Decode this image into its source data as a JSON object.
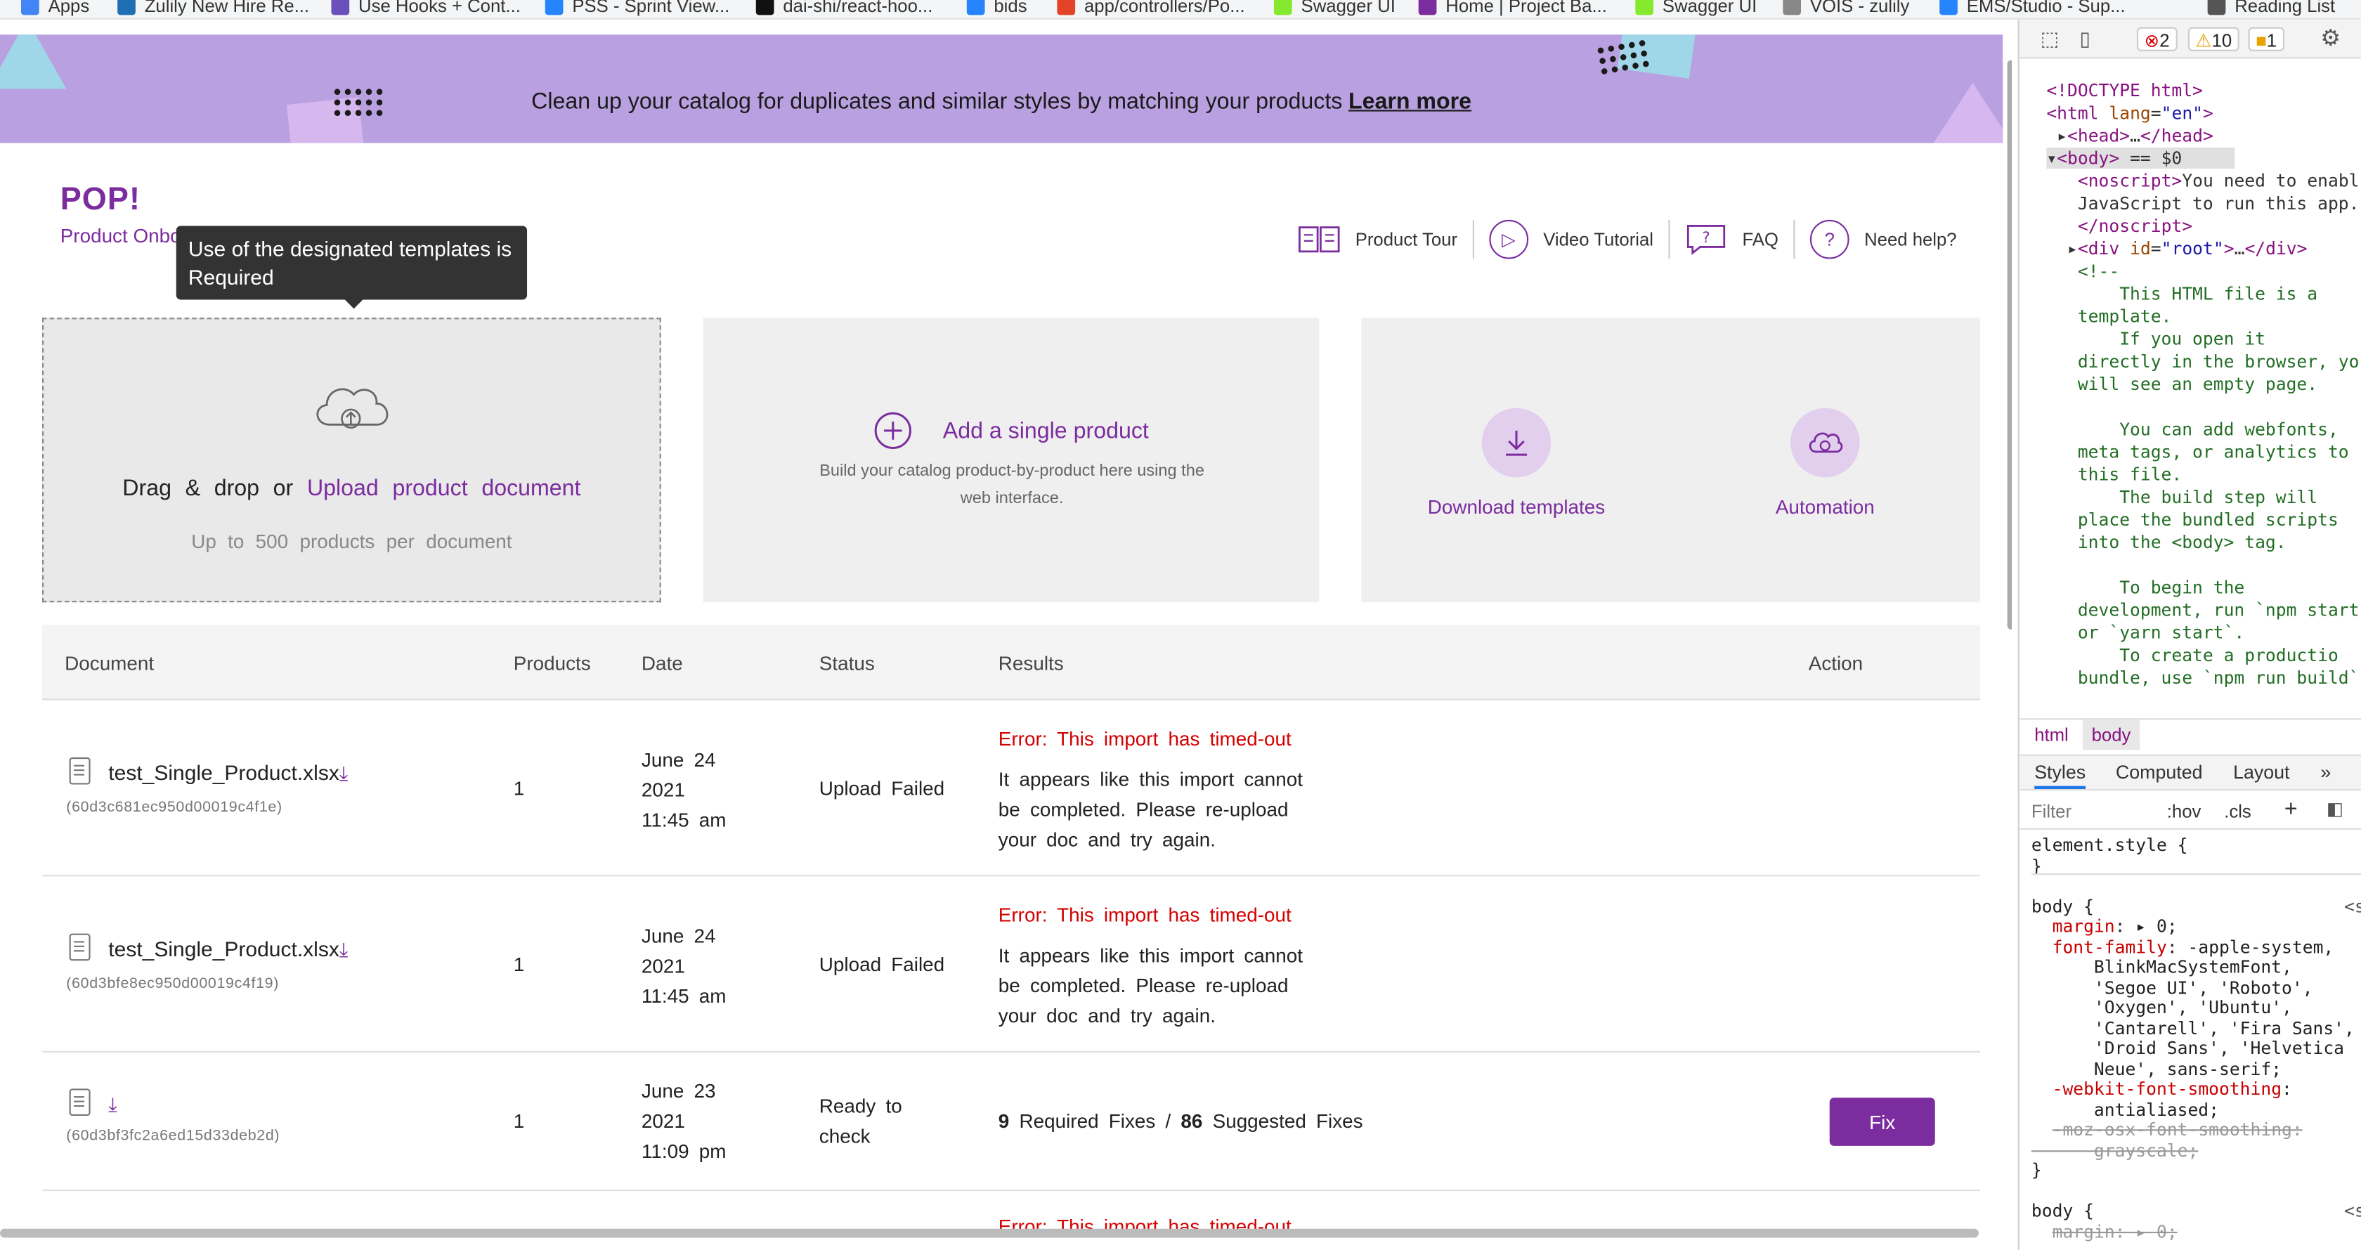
{
  "bookmarks": [
    {
      "label": "Apps",
      "color": "#4285f4"
    },
    {
      "label": "Zulily New Hire Re...",
      "color": "#1f6fb5"
    },
    {
      "label": "Use Hooks + Cont...",
      "color": "#6b4fbb"
    },
    {
      "label": "PSS - Sprint View...",
      "color": "#2684ff"
    },
    {
      "label": "dai-shi/react-hoo...",
      "color": "#111111"
    },
    {
      "label": "bids",
      "color": "#2684ff"
    },
    {
      "label": "app/controllers/Po...",
      "color": "#e24329"
    },
    {
      "label": "Swagger UI",
      "color": "#85ea2d"
    },
    {
      "label": "Home | Project Ba...",
      "color": "#7b2c9e"
    },
    {
      "label": "Swagger UI",
      "color": "#85ea2d"
    },
    {
      "label": "VOIS - zulily",
      "color": "#888888"
    },
    {
      "label": "EMS/Studio - Sup...",
      "color": "#2684ff"
    },
    {
      "label": "Reading List",
      "color": "#555555"
    }
  ],
  "banner": {
    "text": "Clean up your catalog for duplicates and similar styles by matching your products",
    "link": "Learn more"
  },
  "brand": {
    "logo": "POP!",
    "subtitle": "Product Onboarding Platform"
  },
  "tooltip": "Use of the designated templates is Required",
  "help_nav": [
    {
      "label": "Product Tour",
      "icon": "book-icon"
    },
    {
      "label": "Video Tutorial",
      "icon": "play-icon"
    },
    {
      "label": "FAQ",
      "icon": "faq-icon"
    },
    {
      "label": "Need help?",
      "icon": "question-icon"
    }
  ],
  "upload_card": {
    "prefix": "Drag & drop or",
    "link": "Upload product document",
    "sub": "Up to 500 products per document"
  },
  "single_card": {
    "title": "Add a single product",
    "desc": "Build your catalog product-by-product here using the web interface."
  },
  "tiles": {
    "download": "Download templates",
    "automation": "Automation"
  },
  "table": {
    "headers": {
      "document": "Document",
      "products": "Products",
      "date": "Date",
      "status": "Status",
      "results": "Results",
      "action": "Action"
    },
    "rows": [
      {
        "file": "test_Single_Product.xlsx",
        "hash": "(60d3c681ec950d00019c4f1e)",
        "products": "1",
        "date1": "June 24",
        "date2": "2021",
        "date3": "11:45 am",
        "status": "Upload Failed",
        "error": "Error: This import has timed-out",
        "msg1": "It appears like this import cannot",
        "msg2": "be completed. Please re-upload",
        "msg3": "your doc and try again."
      },
      {
        "file": "test_Single_Product.xlsx",
        "hash": "(60d3bfe8ec950d00019c4f19)",
        "products": "1",
        "date1": "June 24",
        "date2": "2021",
        "date3": "11:45 am",
        "status": "Upload Failed",
        "error": "Error: This import has timed-out",
        "msg1": "It appears like this import cannot",
        "msg2": "be completed. Please re-upload",
        "msg3": "your doc and try again."
      },
      {
        "file": "",
        "hash": "(60d3bf3fc2a6ed15d33deb2d)",
        "products": "1",
        "date1": "June 23",
        "date2": "2021",
        "date3": "11:09 pm",
        "status1": "Ready to",
        "status2": "check",
        "required_count": "9",
        "required_label": "Required Fixes /",
        "suggested_count": "86",
        "suggested_label": "Suggested Fixes",
        "action": "Fix"
      }
    ],
    "partial_error": "Error: This import has timed-out"
  },
  "devtools": {
    "errors": "2",
    "warnings": "10",
    "issues": "1",
    "crumbs": [
      "html",
      "body"
    ],
    "tabs": [
      "Styles",
      "Computed",
      "Layout",
      "»"
    ],
    "filter_placeholder": "Filter",
    "filter_hov": ":hov",
    "filter_cls": ".cls"
  },
  "colors": {
    "brand": "#7b2c9e",
    "banner": "#b9a0e0",
    "error": "#d40000"
  }
}
